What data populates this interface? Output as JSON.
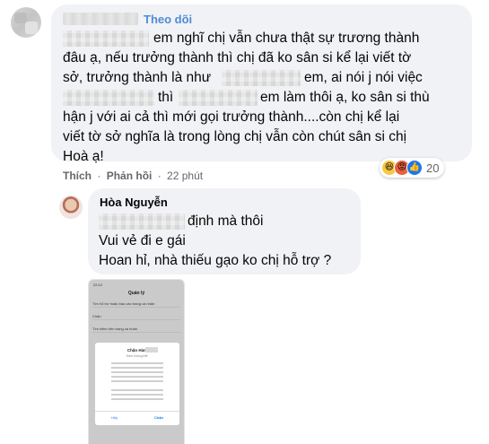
{
  "comment1": {
    "follow_label": "Theo dõi",
    "lines": [
      "đâu ạ, nếu trưởng thành thì chị đã ko sân si kể lại viết tờ",
      "sở, trưởng thành là như",
      "thì",
      "hận j với ai cả thì mới gọi trưởng thành....còn chị kể lại",
      "viết tờ sở nghĩa là trong lòng chị vẫn còn chút sân si chị",
      "Hoà ạ!"
    ],
    "line1_tail": "em nghĩ chị vẫn chưa thật sự trương thành",
    "line3_tail": "em, ai nói j nói việc",
    "line4_tail": "em làm thôi ạ, ko sân si thù",
    "reactions": {
      "icons": [
        "haha-icon",
        "angry-icon",
        "like-icon"
      ],
      "count": "20"
    },
    "actions": {
      "like": "Thích",
      "reply": "Phản hồi",
      "separator": "·",
      "time": "22 phút"
    }
  },
  "reply": {
    "author": "Hòa Nguyễn",
    "line1_tail": "định mà thôi",
    "line2": "Vui vẻ đi e gái",
    "line3": "Hoan hỉ, nhà thiếu gạo ko chị hỗ trợ ?"
  },
  "phone_screenshot": {
    "status": "22:12",
    "title": "Quản lý",
    "rows": [
      "Tìm hỗ trợ hoặc báo cáo trang cá nhân",
      "Chặn",
      "Tìm kiếm trên trang cá nhân"
    ],
    "dialog": {
      "title": "Chặn Hàm",
      "subtitle": "Hàm không thể:",
      "cancel": "Hủy",
      "confirm": "Chặn"
    }
  },
  "colors": {
    "bubble": "#f0f2f5",
    "link": "#4f8bd6",
    "muted": "#65676b",
    "text": "#050505"
  }
}
